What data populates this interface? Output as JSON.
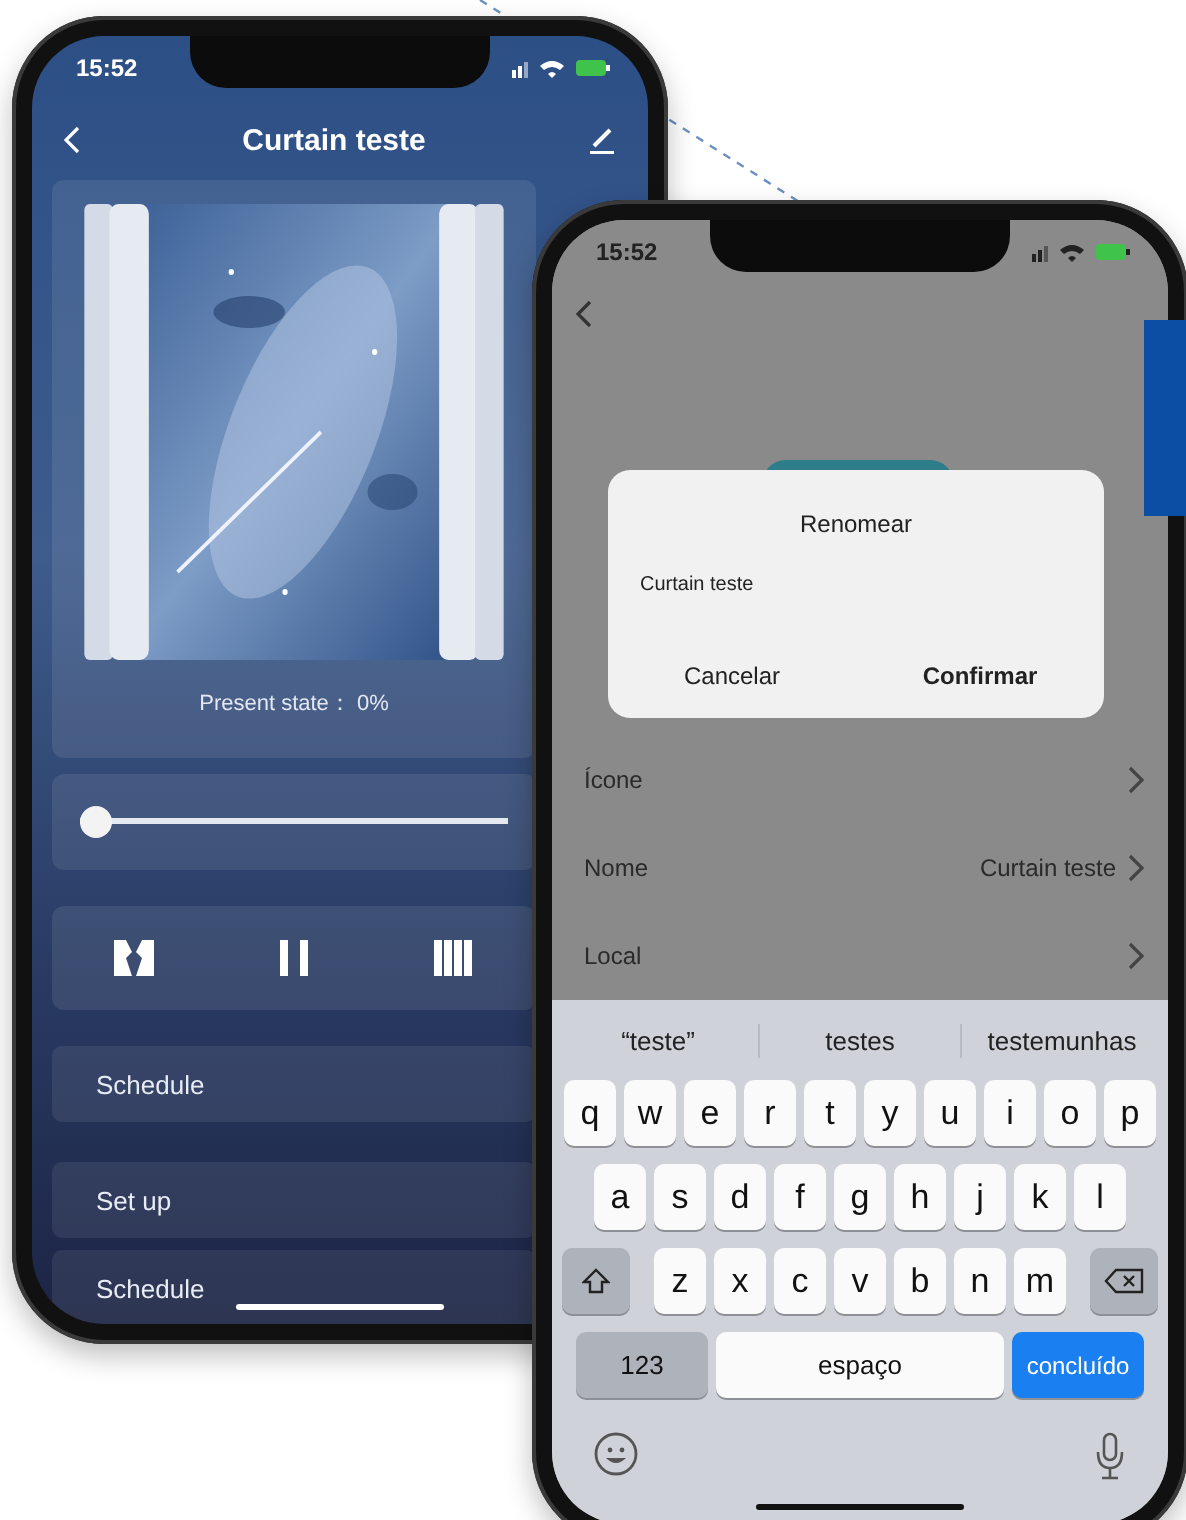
{
  "device_screen": {
    "status_time": "15:52",
    "title": "Curtain teste",
    "present_state": "Present state：  0%",
    "slider": {
      "level": 0
    },
    "controls": [
      {
        "kind": "open"
      },
      {
        "kind": "pause"
      },
      {
        "kind": "close"
      }
    ],
    "menu": [
      "Schedule",
      "Set up",
      "Schedule"
    ]
  },
  "rename_screen": {
    "status_time": "15:52",
    "dialog": {
      "title": "Renomear",
      "value": "Curtain teste",
      "buttons": [
        {
          "label": "Cancelar",
          "kind": "cancel"
        },
        {
          "label": "Confirmar",
          "kind": "confirm"
        }
      ]
    },
    "settings": [
      {
        "label": "Ícone"
      },
      {
        "label": "Nome",
        "value": "Curtain teste"
      },
      {
        "label": "Local"
      }
    ],
    "keyboard": {
      "suggestions": [
        "“teste”",
        "testes",
        "testemunhas"
      ],
      "rows": [
        [
          "q",
          "w",
          "e",
          "r",
          "t",
          "y",
          "u",
          "i",
          "o",
          "p"
        ],
        [
          "a",
          "s",
          "d",
          "f",
          "g",
          "h",
          "j",
          "k",
          "l"
        ],
        [
          "z",
          "x",
          "c",
          "v",
          "b",
          "n",
          "m"
        ]
      ],
      "numbers_key": "123",
      "space_key": "espaço",
      "done_key": "concluído"
    }
  }
}
